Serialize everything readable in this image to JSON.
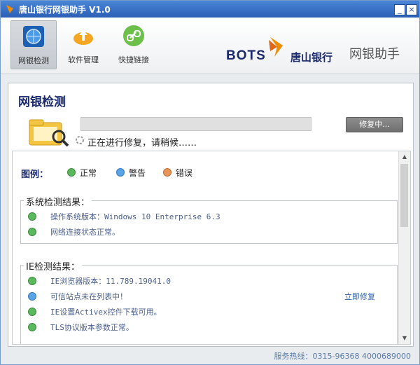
{
  "titlebar": {
    "title": "唐山银行网银助手 V1.0"
  },
  "toolbar": {
    "items": [
      {
        "label": "网银检测",
        "icon": "scan-globe-icon"
      },
      {
        "label": "软件管理",
        "icon": "upload-cloud-icon"
      },
      {
        "label": "快捷链接",
        "icon": "link-icon"
      }
    ]
  },
  "brand": {
    "bots": "BOTS",
    "bank_name": "唐山银行",
    "app_name": "网银助手"
  },
  "page": {
    "title": "网银检测",
    "repair_button": "修复中...",
    "status": "正在进行修复，请稍候……"
  },
  "legend": {
    "label": "图例：",
    "items": [
      {
        "text": "正常",
        "kind": "ok"
      },
      {
        "text": "警告",
        "kind": "warn"
      },
      {
        "text": "错误",
        "kind": "err"
      }
    ]
  },
  "groups": [
    {
      "title": "系统检测结果：",
      "rows": [
        {
          "text": "操作系统版本：Windows 10 Enterprise 6.3",
          "kind": "ok"
        },
        {
          "text": "网络连接状态正常。",
          "kind": "ok"
        }
      ]
    },
    {
      "title": "IE检测结果：",
      "rows": [
        {
          "text": "IE浏览器版本：11.789.19041.0",
          "kind": "ok"
        },
        {
          "text": "可信站点未在列表中！",
          "kind": "warn",
          "action": "立即修复"
        },
        {
          "text": "IE设置Activex控件下载可用。",
          "kind": "ok"
        },
        {
          "text": "TLS协议版本参数正常。",
          "kind": "ok"
        }
      ]
    }
  ],
  "footer": {
    "hotline": "服务热线：0315-96368 4000689000"
  },
  "colors": {
    "titlebar": "#2a5fb5",
    "brand": "#1a2a6c",
    "accent_orange": "#f08c00"
  }
}
